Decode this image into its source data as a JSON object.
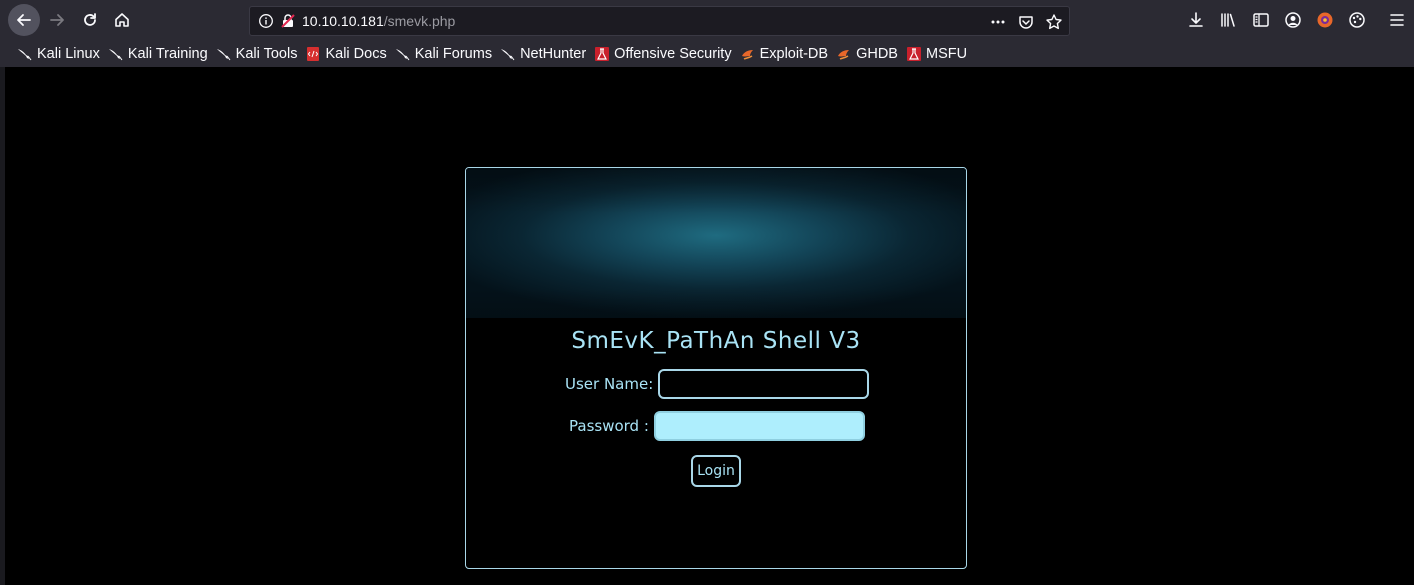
{
  "browser": {
    "url_host": "10.10.10.181",
    "url_path": "/smevk.php",
    "bookmarks": [
      {
        "label": "Kali Linux",
        "icon": "kali-dragon-icon"
      },
      {
        "label": "Kali Training",
        "icon": "kali-dragon-icon"
      },
      {
        "label": "Kali Tools",
        "icon": "kali-dragon-icon"
      },
      {
        "label": "Kali Docs",
        "icon": "kali-docs-icon"
      },
      {
        "label": "Kali Forums",
        "icon": "kali-dragon-icon"
      },
      {
        "label": "NetHunter",
        "icon": "kali-dragon-icon"
      },
      {
        "label": "Offensive Security",
        "icon": "offsec-icon"
      },
      {
        "label": "Exploit-DB",
        "icon": "exploitdb-icon"
      },
      {
        "label": "GHDB",
        "icon": "exploitdb-icon"
      },
      {
        "label": "MSFU",
        "icon": "offsec-icon"
      }
    ]
  },
  "login": {
    "title": "SmEvK_PaThAn Shell V3",
    "username_label": "User Name:",
    "username_value": "",
    "password_label": "Password :",
    "password_value": "",
    "button_label": "Login"
  },
  "colors": {
    "accent": "#a9e3f5",
    "chrome": "#2b2a33",
    "page_bg": "#000000"
  }
}
